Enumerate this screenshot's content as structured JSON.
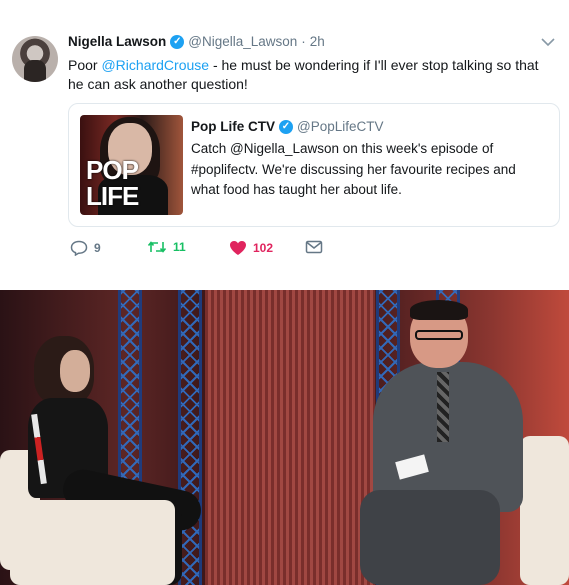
{
  "tweet": {
    "author_name": "Nigella Lawson",
    "author_handle": "@Nigella_Lawson",
    "separator": "·",
    "time": "2h",
    "text_before": "Poor ",
    "mention": "@RichardCrouse",
    "text_after": " - he must be wondering if I'll ever stop talking so that he can ask another question!",
    "verified_mark": "✓",
    "caret_icon": "chevron-down-icon"
  },
  "quote": {
    "author_name": "Pop Life CTV",
    "author_handle": "@PopLifeCTV",
    "verified_mark": "✓",
    "text": "Catch @Nigella_Lawson on this week's episode of #poplifectv. We're discussing her favourite recipes and what food has taught her about life.",
    "media_logo": "POP LIFE"
  },
  "actions": {
    "reply_count": "9",
    "retweet_count": "11",
    "like_count": "102"
  },
  "colors": {
    "link": "#1da1f2",
    "retweet": "#17bf63",
    "like": "#e0245e",
    "muted": "#657786"
  }
}
